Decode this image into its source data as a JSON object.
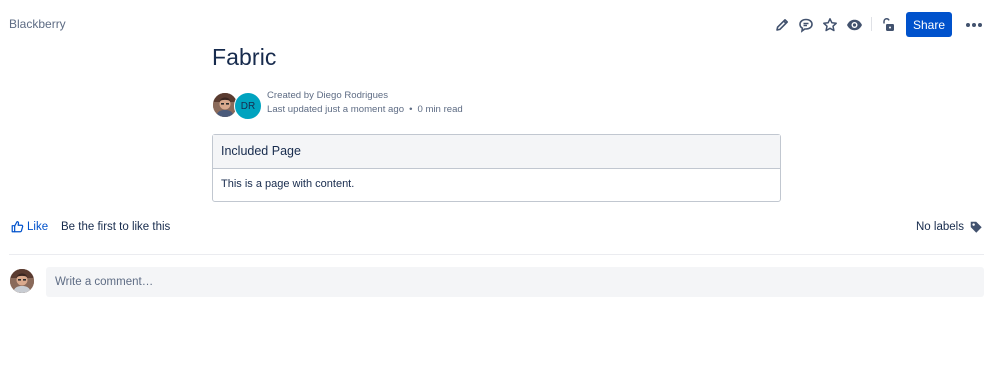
{
  "header": {
    "space_name": "Blackberry",
    "share_label": "Share",
    "icons": [
      "edit-icon",
      "comment-icon",
      "star-icon",
      "watch-eye-icon",
      "restrictions-unlock-icon",
      "more-actions-icon"
    ]
  },
  "page": {
    "title": "Fabric",
    "byline": {
      "created_by": "Created by Diego Rodrigues",
      "last_updated": "Last updated just a moment ago",
      "separator": "•",
      "read_time": "0 min read"
    },
    "contributors": [
      {
        "type": "photo"
      },
      {
        "type": "initials",
        "initials": "DR",
        "color": "#00a3bf"
      }
    ],
    "include_macro": {
      "heading": "Included Page",
      "body": "This is a page with content."
    }
  },
  "footer": {
    "like_label": "Like",
    "like_text": "Be the first to like this",
    "labels_text": "No labels"
  },
  "comments": {
    "placeholder": "Write a comment…"
  },
  "colors": {
    "accent": "#0052cc",
    "text": "#172b4d",
    "subtle": "#5e6c84"
  }
}
